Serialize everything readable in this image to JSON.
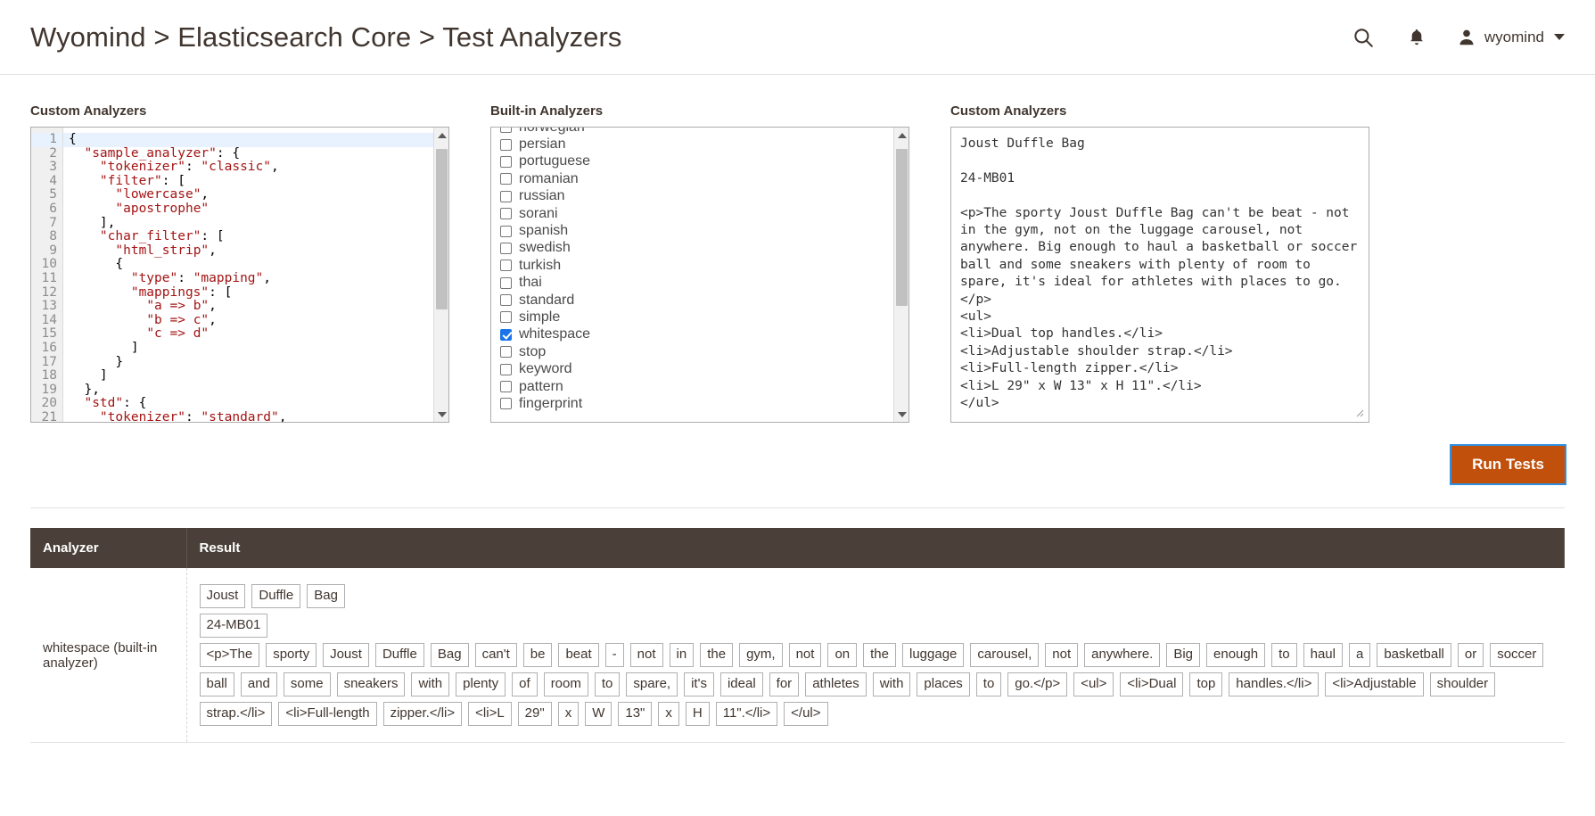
{
  "header": {
    "title": "Wyomind > Elasticsearch Core > Test Analyzers",
    "search_icon": "search-icon",
    "bell_icon": "notifications-bell-icon",
    "user_name": "wyomind",
    "avatar_icon": "user-avatar-icon",
    "caret_icon": "chevron-down-icon"
  },
  "custom_analyzers_editor": {
    "label": "Custom Analyzers",
    "active_line": 1,
    "lines": [
      "{",
      "  \"sample_analyzer\": {",
      "    \"tokenizer\": \"classic\",",
      "    \"filter\": [",
      "      \"lowercase\",",
      "      \"apostrophe\"",
      "    ],",
      "    \"char_filter\": [",
      "      \"html_strip\",",
      "      {",
      "        \"type\": \"mapping\",",
      "        \"mappings\": [",
      "          \"a => b\",",
      "          \"b => c\",",
      "          \"c => d\"",
      "        ]",
      "      }",
      "    ]",
      "  },",
      "  \"std\": {",
      "    \"tokenizer\": \"standard\","
    ]
  },
  "builtin_analyzers": {
    "label": "Built-in Analyzers",
    "items": [
      {
        "label": "norwegian",
        "checked": false
      },
      {
        "label": "persian",
        "checked": false
      },
      {
        "label": "portuguese",
        "checked": false
      },
      {
        "label": "romanian",
        "checked": false
      },
      {
        "label": "russian",
        "checked": false
      },
      {
        "label": "sorani",
        "checked": false
      },
      {
        "label": "spanish",
        "checked": false
      },
      {
        "label": "swedish",
        "checked": false
      },
      {
        "label": "turkish",
        "checked": false
      },
      {
        "label": "thai",
        "checked": false
      },
      {
        "label": "standard",
        "checked": false
      },
      {
        "label": "simple",
        "checked": false
      },
      {
        "label": "whitespace",
        "checked": true
      },
      {
        "label": "stop",
        "checked": false
      },
      {
        "label": "keyword",
        "checked": false
      },
      {
        "label": "pattern",
        "checked": false
      },
      {
        "label": "fingerprint",
        "checked": false
      }
    ]
  },
  "test_text": {
    "label": "Custom Analyzers",
    "value": "Joust Duffle Bag\n\n24-MB01\n\n<p>The sporty Joust Duffle Bag can't be beat - not in the gym, not on the luggage carousel, not anywhere. Big enough to haul a basketball or soccer ball and some sneakers with plenty of room to spare, it's ideal for athletes with places to go.</p>\n<ul>\n<li>Dual top handles.</li>\n<li>Adjustable shoulder strap.</li>\n<li>Full-length zipper.</li>\n<li>L 29\" x W 13\" x H 11\".</li>\n</ul>"
  },
  "actions": {
    "run_tests_label": "Run Tests"
  },
  "results": {
    "columns": [
      "Analyzer",
      "Result"
    ],
    "rows": [
      {
        "analyzer": "whitespace (built-in analyzer)",
        "token_lines": [
          [
            "Joust",
            "Duffle",
            "Bag"
          ],
          [
            "24-MB01"
          ],
          [
            "<p>The",
            "sporty",
            "Joust",
            "Duffle",
            "Bag",
            "can't",
            "be",
            "beat",
            "-",
            "not",
            "in",
            "the",
            "gym,",
            "not",
            "on",
            "the",
            "luggage",
            "carousel,",
            "not",
            "anywhere.",
            "Big",
            "enough",
            "to",
            "haul",
            "a",
            "basketball",
            "or",
            "soccer",
            "ball",
            "and",
            "some",
            "sneakers",
            "with",
            "plenty",
            "of",
            "room",
            "to",
            "spare,",
            "it's",
            "ideal",
            "for",
            "athletes",
            "with",
            "places",
            "to",
            "go.</p>",
            "<ul>",
            "<li>Dual",
            "top",
            "handles.</li>",
            "<li>Adjustable",
            "shoulder",
            "strap.</li>",
            "<li>Full-length",
            "zipper.</li>",
            "<li>L",
            "29\"",
            "x",
            "W",
            "13\"",
            "x",
            "H",
            "11\".</li>",
            "</ul>"
          ]
        ]
      }
    ]
  },
  "colors": {
    "accent_orange": "#c0500c",
    "table_header": "#4a4039",
    "checkbox_checked": "#1a73e8",
    "code_string": "#a31515"
  }
}
